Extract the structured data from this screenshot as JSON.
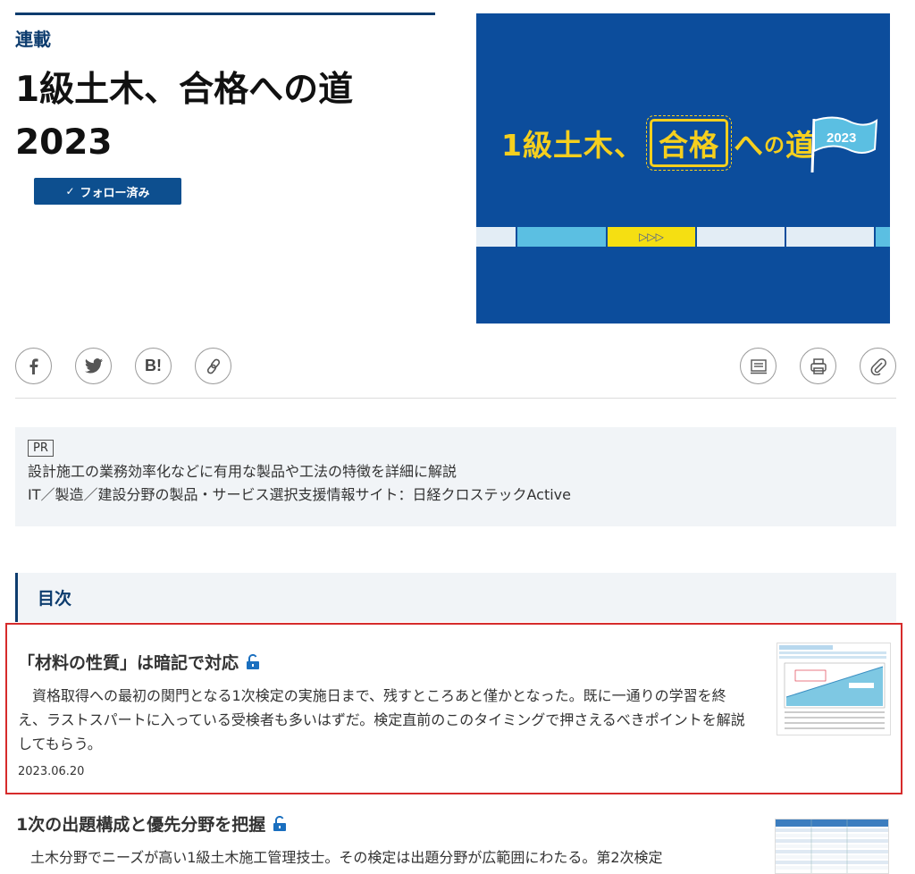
{
  "header": {
    "kicker": "連載",
    "title_line1": "1級土木、合格への道",
    "title_line2": "2023",
    "follow_label": "フォロー済み"
  },
  "hero": {
    "text_pre": "1級土木、",
    "text_boxed": "合格",
    "text_he": "へ",
    "text_no": "の",
    "text_michi": "道",
    "flag_year": "2023",
    "arrows": "▷▷▷"
  },
  "share": {
    "icons": [
      "facebook-icon",
      "twitter-icon",
      "hatena-bookmark-icon",
      "link-icon",
      "note-icon",
      "print-icon",
      "clip-icon"
    ],
    "hatena_label": "B!"
  },
  "pr": {
    "tag": "PR",
    "line1": "設計施工の業務効率化などに有用な製品や工法の特徴を詳細に解説",
    "line2": "IT／製造／建設分野の製品・サービス選択支援情報サイト：日経クロステックActive"
  },
  "toc": {
    "heading": "目次"
  },
  "articles": [
    {
      "title": "「材料の性質」は暗記で対応",
      "body": "資格取得への最初の関門となる1次検定の実施日まで、残すところあと僅かとなった。既に一通りの学習を終え、ラストスパートに入っている受検者も多いはずだ。検定直前のこのタイミングで押さえるべきポイントを解説してもらう。",
      "date": "2023.06.20"
    },
    {
      "title": "1次の出題構成と優先分野を把握",
      "body": "土木分野でニーズが高い1級土木施工管理技士。その検定は出題分野が広範囲にわたる。第2次検定"
    }
  ],
  "colors": {
    "navy": "#0d3c6e",
    "hero_blue": "#0c4d9c",
    "hero_yellow": "#f5cf1e",
    "selection_red": "#d62b2b",
    "lock_blue": "#1a6fbf"
  }
}
